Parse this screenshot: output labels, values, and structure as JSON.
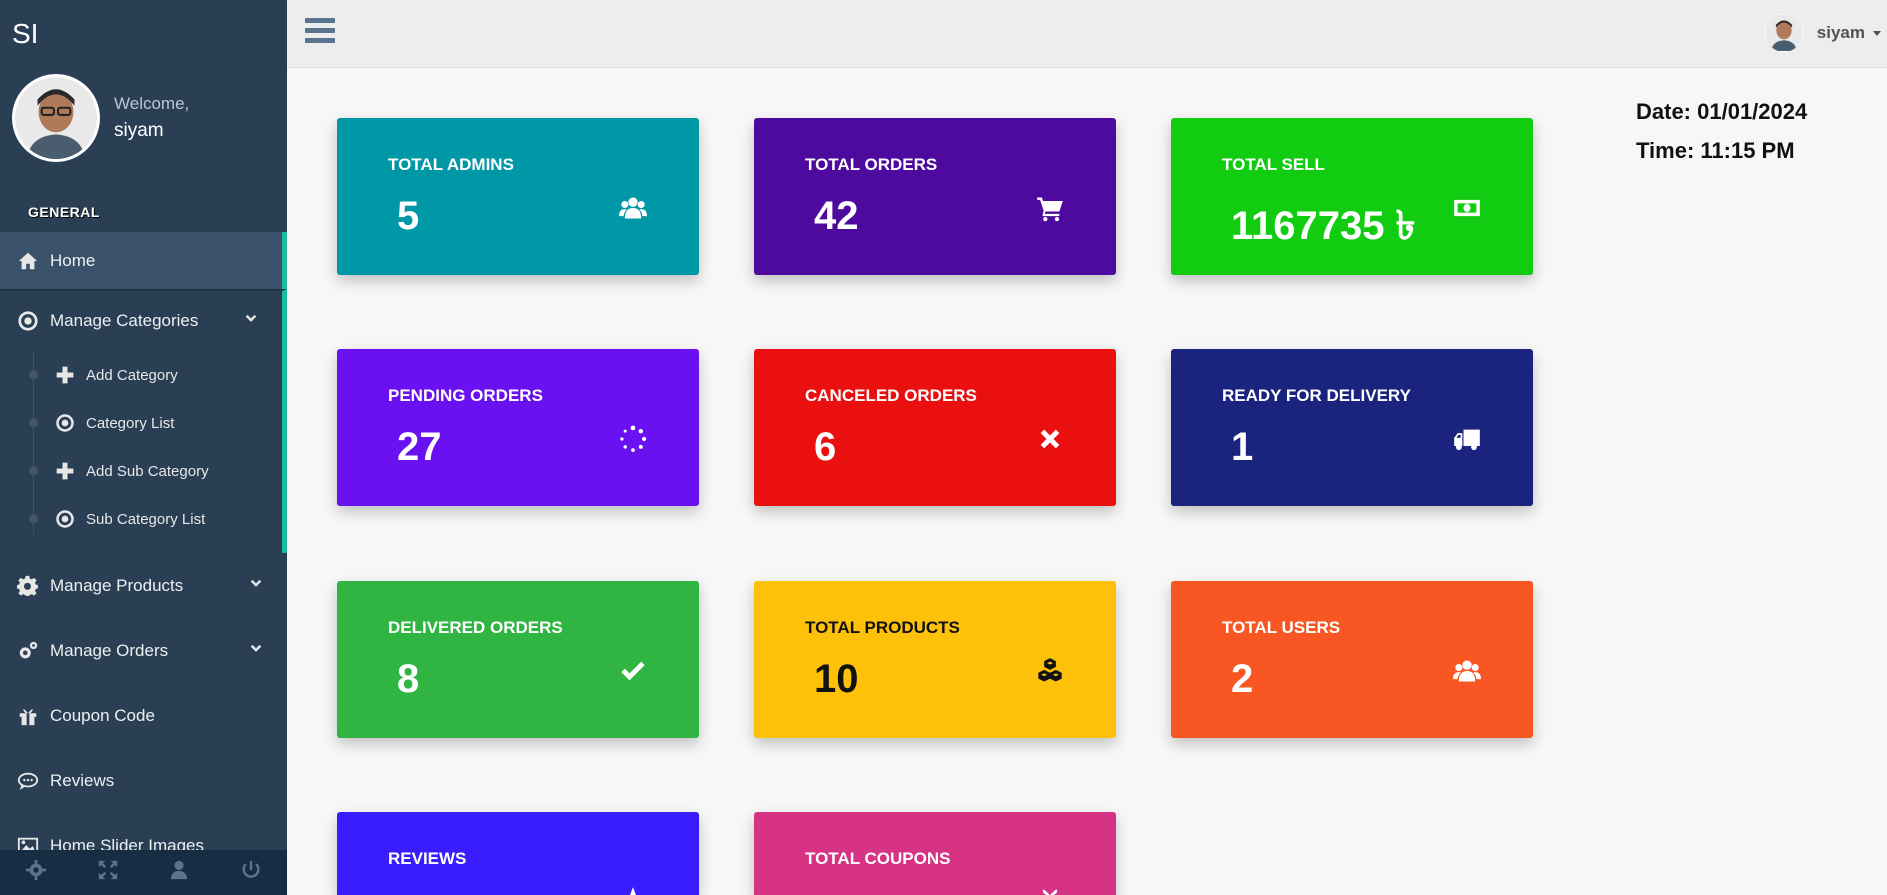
{
  "sidebar": {
    "brand": "SI",
    "welcome": "Welcome,",
    "username": "siyam",
    "section_title": "GENERAL",
    "home": "Home",
    "manage_categories": "Manage Categories",
    "sub_items": [
      "Add Category",
      "Category List",
      "Add Sub Category",
      "Sub Category List"
    ],
    "manage_products": "Manage Products",
    "manage_orders": "Manage Orders",
    "coupon_code": "Coupon Code",
    "reviews": "Reviews",
    "home_slider": "Home Slider Images"
  },
  "topnav": {
    "username": "siyam"
  },
  "datetime": {
    "date": "Date: 01/01/2024",
    "time": "Time: 11:15 PM"
  },
  "cards": [
    {
      "label": "TOTAL ADMINS",
      "value": "5",
      "color": "#0097a7",
      "icon": "users-icon"
    },
    {
      "label": "TOTAL ORDERS",
      "value": "42",
      "color": "#4e0a9e",
      "icon": "cart-icon"
    },
    {
      "label": "TOTAL SELL",
      "value": "1167735 ৳",
      "color": "#12cc12",
      "icon": "money-icon"
    },
    {
      "label": "PENDING ORDERS",
      "value": "27",
      "color": "#6a11f2",
      "icon": "spinner-icon"
    },
    {
      "label": "CANCELED ORDERS",
      "value": "6",
      "color": "#eb1010",
      "icon": "close-icon"
    },
    {
      "label": "READY FOR DELIVERY",
      "value": "1",
      "color": "#1a237e",
      "icon": "truck-icon"
    },
    {
      "label": "DELIVERED ORDERS",
      "value": "8",
      "color": "#30b543",
      "icon": "check-icon"
    },
    {
      "label": "TOTAL PRODUCTS",
      "value": "10",
      "color": "#fec109",
      "icon": "cubes-icon"
    },
    {
      "label": "TOTAL USERS",
      "value": "2",
      "color": "#f85723",
      "icon": "users-icon"
    },
    {
      "label": "REVIEWS",
      "value": "",
      "color": "#3a1dfd",
      "icon": "star-icon"
    },
    {
      "label": "TOTAL COUPONS",
      "value": "",
      "color": "#d63384",
      "icon": "gift-icon"
    }
  ]
}
